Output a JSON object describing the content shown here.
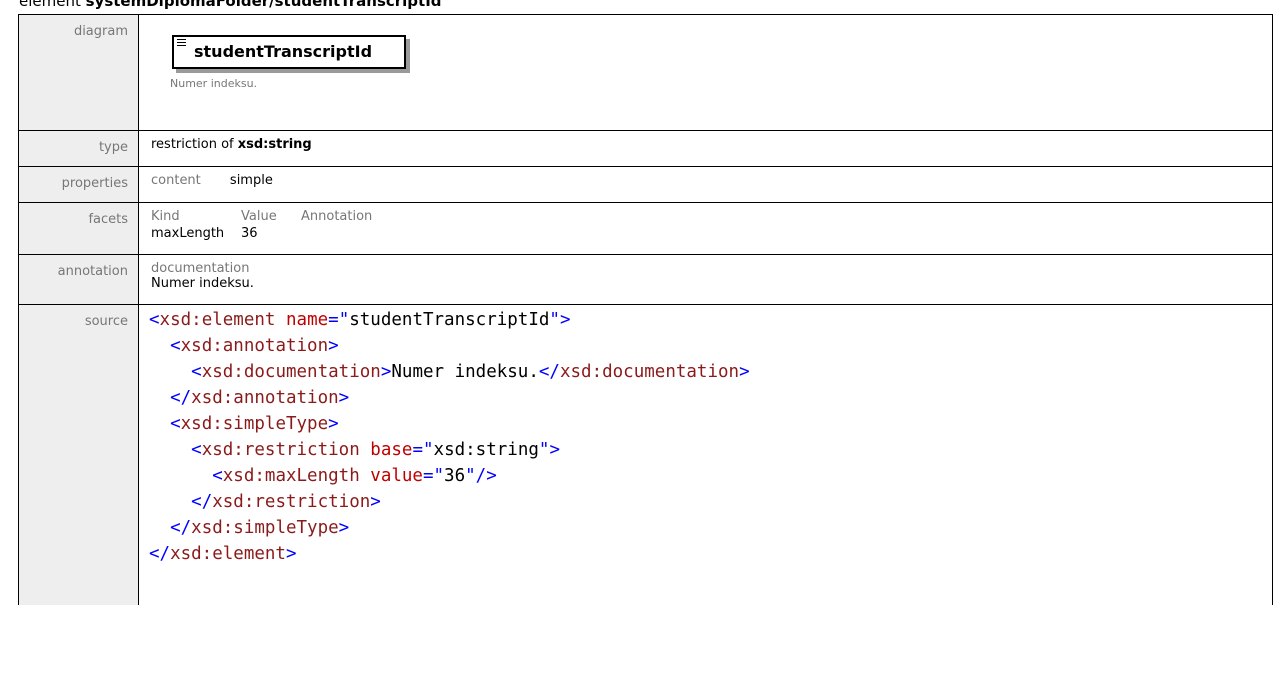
{
  "page_title_prefix": "element ",
  "page_title_path": "systemDiplomaFolder/studentTranscriptId",
  "diagram": {
    "label": "diagram",
    "element_name": "studentTranscriptId",
    "annotation": "Numer indeksu."
  },
  "type": {
    "label": "type",
    "prefix": "restriction of ",
    "base": "xsd:string"
  },
  "properties": {
    "label": "properties",
    "key": "content",
    "value": "simple"
  },
  "facets": {
    "label": "facets",
    "headers": [
      "Kind",
      "Value",
      "Annotation"
    ],
    "rows": [
      {
        "kind": "maxLength",
        "value": "36",
        "annotation": ""
      }
    ]
  },
  "annotation": {
    "label": "annotation",
    "key": "documentation",
    "value": "Numer indeksu."
  },
  "source": {
    "label": "source",
    "lines": [
      "<xsd:element name=\"studentTranscriptId\">",
      "  <xsd:annotation>",
      "    <xsd:documentation>Numer indeksu.</xsd:documentation>",
      "  </xsd:annotation>",
      "  <xsd:simpleType>",
      "    <xsd:restriction base=\"xsd:string\">",
      "      <xsd:maxLength value=\"36\"/>",
      "    </xsd:restriction>",
      "  </xsd:simpleType>",
      "</xsd:element>"
    ]
  }
}
